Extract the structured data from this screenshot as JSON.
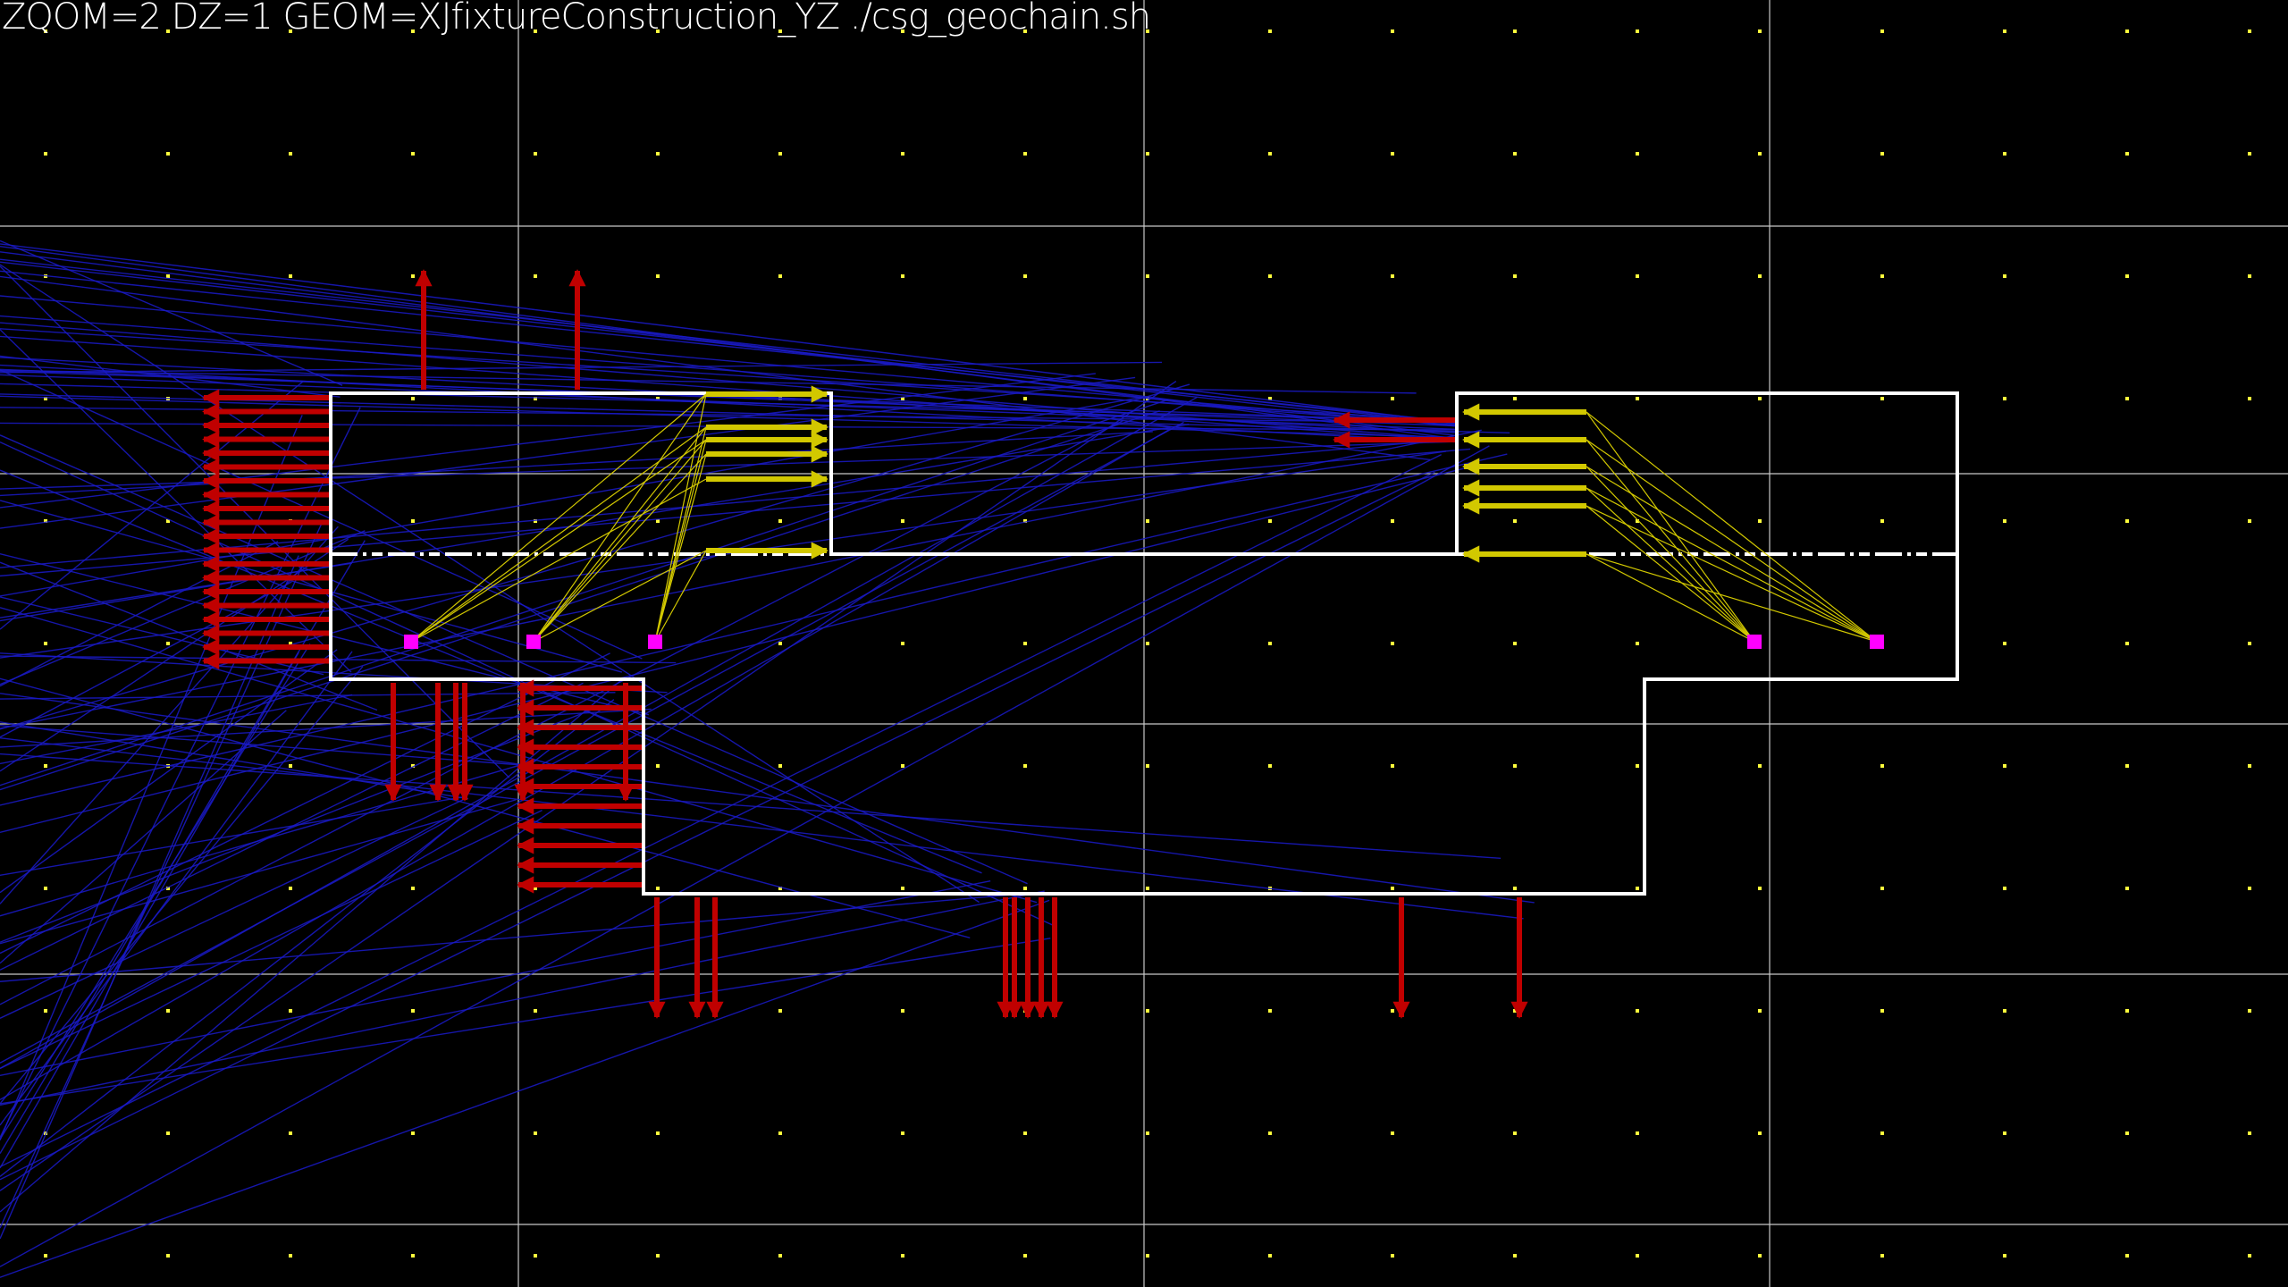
{
  "window": {
    "title": "ZQOM=2 DZ=1 GEOM=XJfixtureConstruction_YZ ./csg_geochain.sh"
  },
  "colors": {
    "background": "#000000",
    "grid_line": "#c8c8c8",
    "grid_dot": "#ffff3c",
    "outline": "#ffffff",
    "ray": "#1a1ac8",
    "normal_arrow": "#c00000",
    "intersect_arrow": "#d2c800",
    "source_marker": "#ff00ff"
  },
  "icons": {
    "normal": "red-arrow-icon",
    "intersect": "yellow-arrow-icon",
    "source": "magenta-square-icon"
  }
}
